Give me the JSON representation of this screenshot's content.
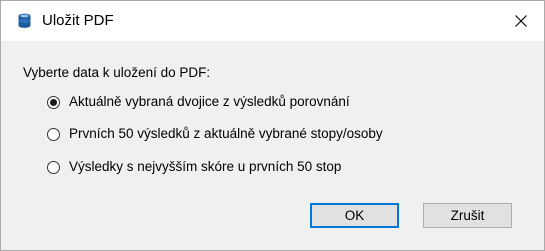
{
  "window": {
    "title": "Uložit PDF",
    "close_icon": "close-icon",
    "app_icon": "app-icon"
  },
  "content": {
    "prompt": "Vyberte data k uložení do PDF:",
    "options": [
      {
        "label": "Aktuálně vybraná dvojice z výsledků porovnání",
        "selected": true
      },
      {
        "label": "Prvních 50 výsledků z aktuálně vybrané stopy/osoby",
        "selected": false
      },
      {
        "label": "Výsledky s nejvyšším skóre u prvních 50 stop",
        "selected": false
      }
    ]
  },
  "buttons": {
    "ok": "OK",
    "cancel": "Zrušit"
  },
  "colors": {
    "dialog_bg": "#f0f0f0",
    "titlebar_bg": "#ffffff",
    "default_button_border": "#0078d7",
    "button_bg": "#e1e1e1",
    "app_icon_blue": "#2b6fb6"
  }
}
